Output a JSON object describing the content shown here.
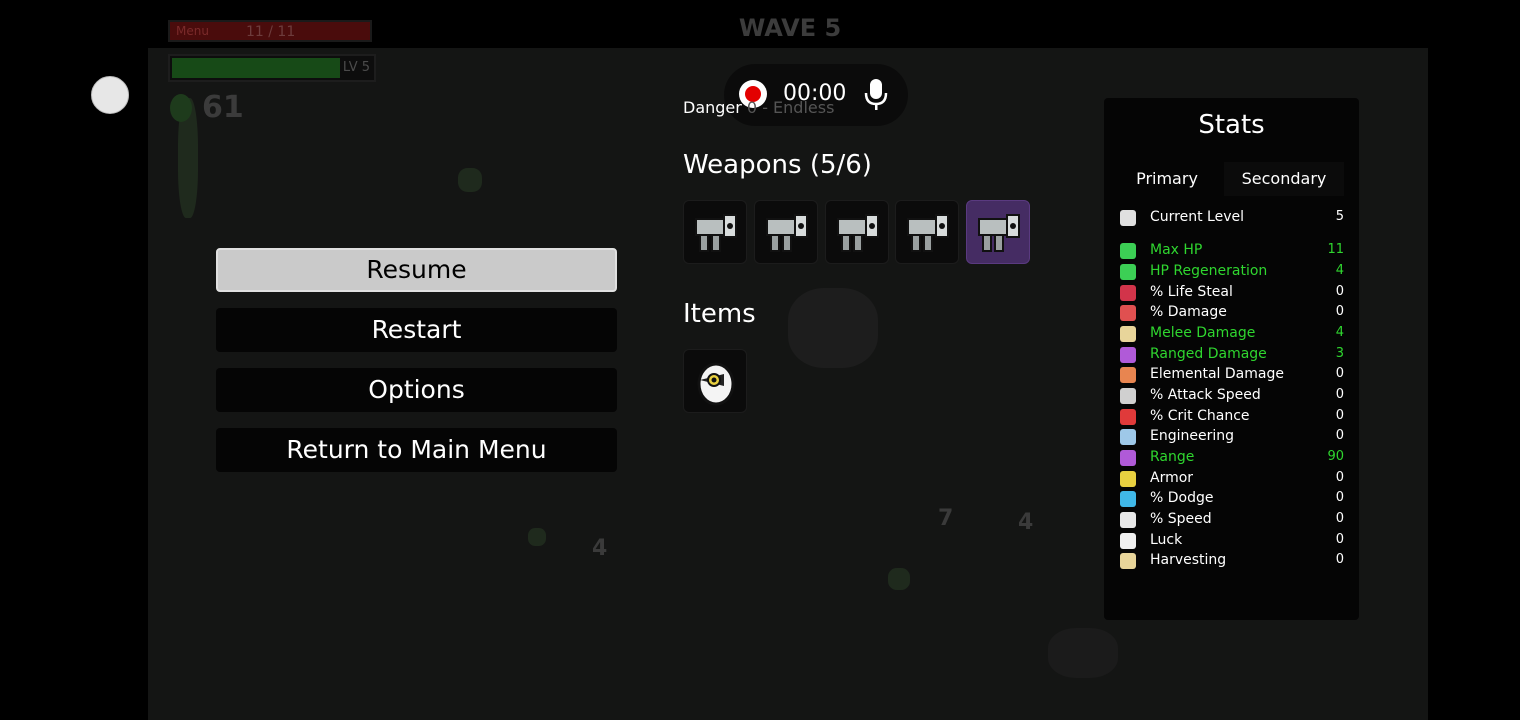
{
  "hud": {
    "hp_label": "Menu",
    "hp_value": "11 / 11",
    "level_label": "LV 5",
    "materials": "61",
    "wave_title": "WAVE 5"
  },
  "recorder": {
    "timer": "00:00"
  },
  "pause_menu": {
    "resume": "Resume",
    "restart": "Restart",
    "options": "Options",
    "return_main": "Return to Main Menu"
  },
  "run": {
    "danger_text": "Danger",
    "danger_rest": " 0 - Endless",
    "weapons_title": "Weapons (5/6)",
    "items_title": "Items"
  },
  "weapons": [
    {
      "name": "minigun-icon",
      "tier": 1
    },
    {
      "name": "minigun-icon",
      "tier": 1
    },
    {
      "name": "minigun-icon",
      "tier": 1
    },
    {
      "name": "minigun-icon",
      "tier": 1
    },
    {
      "name": "minigun-icon",
      "tier": 2
    }
  ],
  "items": [
    {
      "name": "penguin-egg-icon"
    }
  ],
  "stats": {
    "title": "Stats",
    "tab_primary": "Primary",
    "tab_secondary": "Secondary",
    "rows": [
      {
        "name": "Current Level",
        "value": "5",
        "color": "#ffffff",
        "icon_color": "#e0e0e0"
      },
      {
        "name": "Max HP",
        "value": "11",
        "color": "#2fd62f",
        "icon_color": "#3ccf55"
      },
      {
        "name": "HP Regeneration",
        "value": "4",
        "color": "#2fd62f",
        "icon_color": "#3ccf55"
      },
      {
        "name": "% Life Steal",
        "value": "0",
        "color": "#ffffff",
        "icon_color": "#d2344a"
      },
      {
        "name": "% Damage",
        "value": "0",
        "color": "#ffffff",
        "icon_color": "#e05050"
      },
      {
        "name": "Melee Damage",
        "value": "4",
        "color": "#2fd62f",
        "icon_color": "#e8d59a"
      },
      {
        "name": "Ranged Damage",
        "value": "3",
        "color": "#2fd62f",
        "icon_color": "#b05ad8"
      },
      {
        "name": "Elemental Damage",
        "value": "0",
        "color": "#ffffff",
        "icon_color": "#e88550"
      },
      {
        "name": "% Attack Speed",
        "value": "0",
        "color": "#ffffff",
        "icon_color": "#d0d0d0"
      },
      {
        "name": "% Crit Chance",
        "value": "0",
        "color": "#ffffff",
        "icon_color": "#e03a3a"
      },
      {
        "name": "Engineering",
        "value": "0",
        "color": "#ffffff",
        "icon_color": "#9ec8e8"
      },
      {
        "name": "Range",
        "value": "90",
        "color": "#2fd62f",
        "icon_color": "#b05ad8"
      },
      {
        "name": "Armor",
        "value": "0",
        "color": "#ffffff",
        "icon_color": "#e8d040"
      },
      {
        "name": "% Dodge",
        "value": "0",
        "color": "#ffffff",
        "icon_color": "#40b8e8"
      },
      {
        "name": "% Speed",
        "value": "0",
        "color": "#ffffff",
        "icon_color": "#e8e8e8"
      },
      {
        "name": "Luck",
        "value": "0",
        "color": "#ffffff",
        "icon_color": "#f0f0f0"
      },
      {
        "name": "Harvesting",
        "value": "0",
        "color": "#ffffff",
        "icon_color": "#e8d59a"
      }
    ]
  }
}
